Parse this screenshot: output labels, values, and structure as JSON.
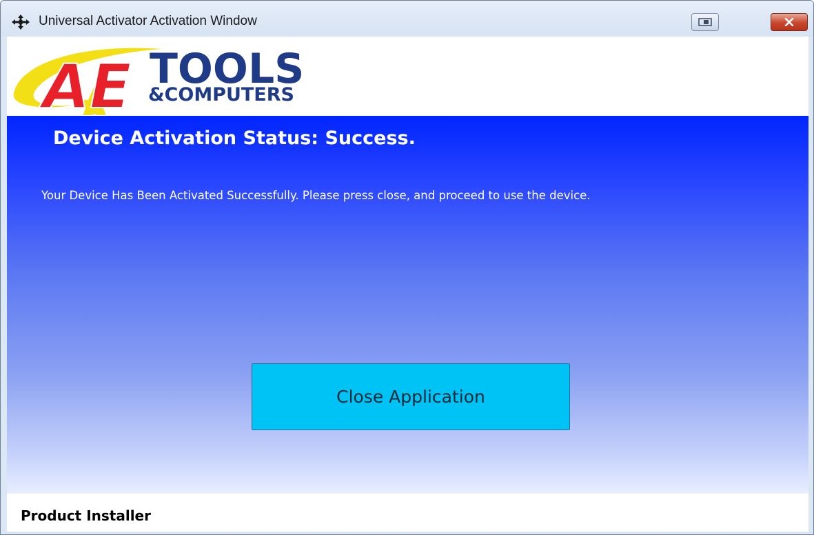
{
  "window": {
    "title": "Universal Activator Activation Window",
    "icon": "move-arrows-icon",
    "controls": {
      "restore_icon": "restore-icon",
      "close_icon": "close-x-icon"
    }
  },
  "logo": {
    "monogram": "AE",
    "line1": "TOOLS",
    "line2": "&COMPUTERS",
    "colors": {
      "red": "#e8202a",
      "navy": "#1f3a86",
      "yellow": "#f3df16"
    }
  },
  "status": {
    "title": "Device Activation Status: Success.",
    "message": "Your Device Has Been Activated Successfully. Please press close, and proceed to use the device."
  },
  "close_button": {
    "label": "Close Application",
    "color": "#00c3f5"
  },
  "footer": {
    "label": "Product Installer"
  },
  "theme": {
    "gradient_top": "#0025ff",
    "gradient_bottom": "#e9eeff"
  }
}
